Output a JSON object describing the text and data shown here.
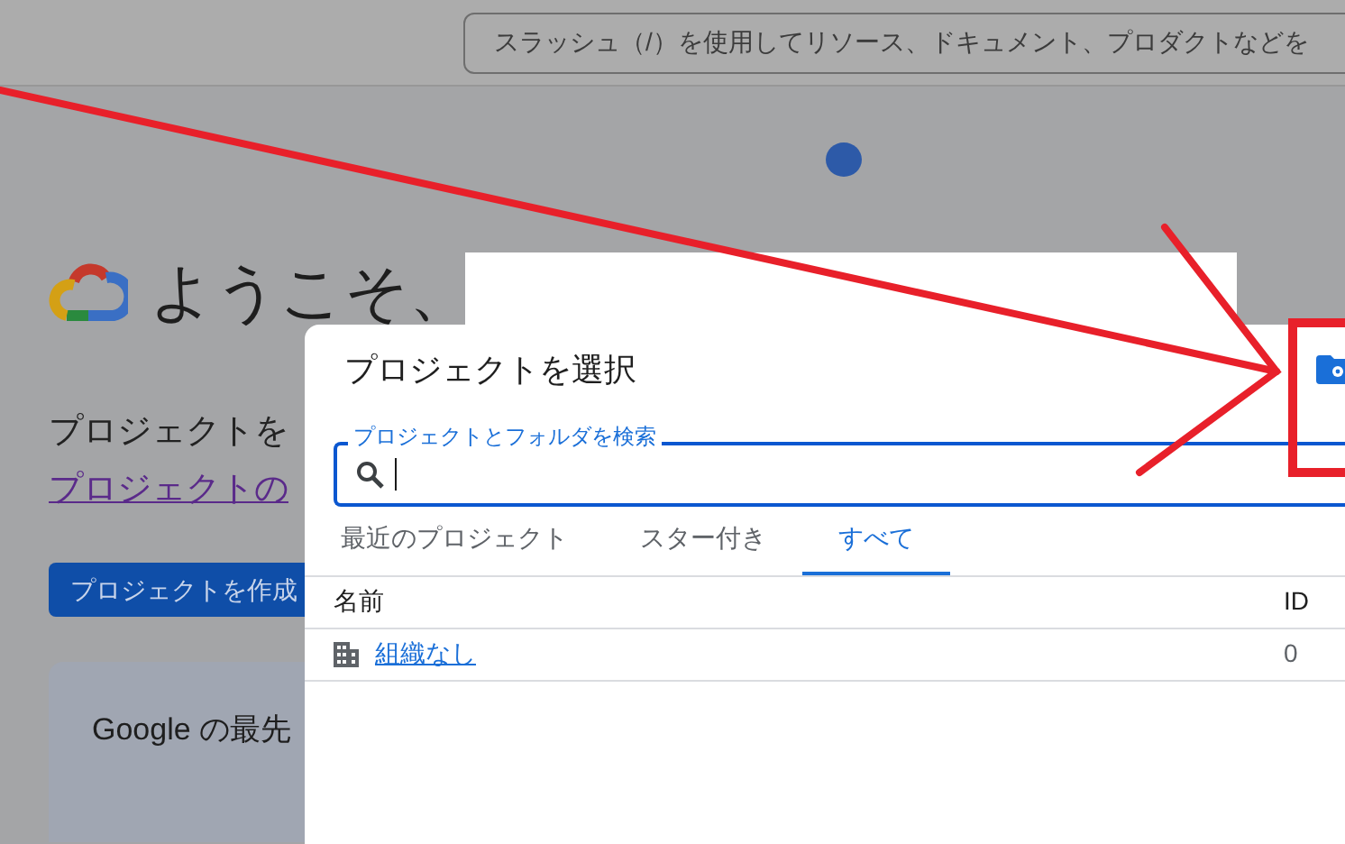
{
  "header": {
    "search_placeholder": "スラッシュ（/）を使用してリソース、ドキュメント、プロダクトなどを"
  },
  "welcome": {
    "title": "ようこそ、",
    "text": "プロジェクトを",
    "link": "プロジェクトの",
    "create_button": "プロジェクトを作成",
    "card_text": "Google の最先"
  },
  "dialog": {
    "title": "プロジェクトを選択",
    "search": {
      "label": "プロジェクトとフォルダを検索"
    },
    "tabs": [
      {
        "label": "最近のプロジェクト",
        "selected": false
      },
      {
        "label": "スター付き",
        "selected": false
      },
      {
        "label": "すべて",
        "selected": true
      }
    ],
    "table": {
      "columns": [
        "名前",
        "ID"
      ],
      "rows": [
        {
          "name": "組織なし",
          "id": "0"
        }
      ]
    }
  }
}
